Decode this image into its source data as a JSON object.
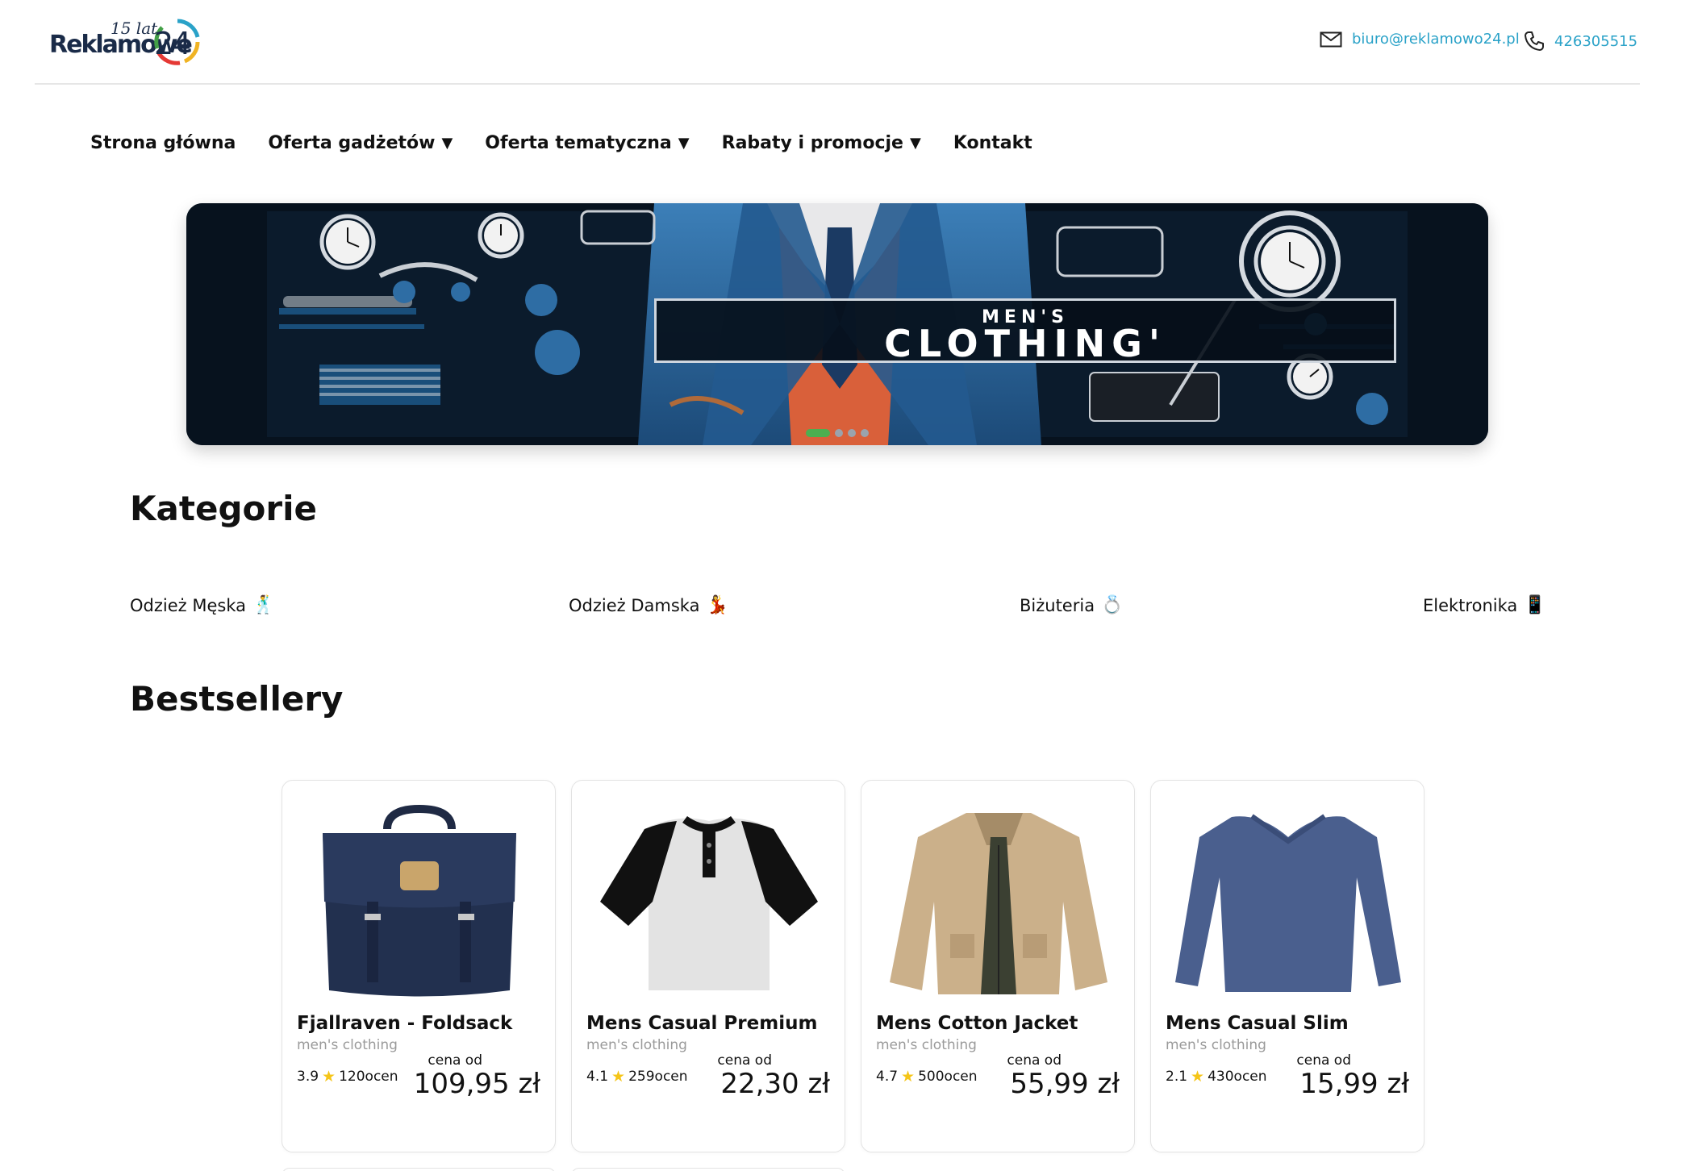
{
  "header": {
    "logo_main": "Reklamowe",
    "logo_years": "15 lat",
    "logo_number": "24",
    "email": "biuro@reklamowo24.pl",
    "phone": "426305515"
  },
  "nav": {
    "items": [
      {
        "label": "Strona główna",
        "has_dropdown": false
      },
      {
        "label": "Oferta gadżetów",
        "has_dropdown": true
      },
      {
        "label": "Oferta tematyczna",
        "has_dropdown": true
      },
      {
        "label": "Rabaty i promocje",
        "has_dropdown": true
      },
      {
        "label": "Kontakt",
        "has_dropdown": false
      }
    ],
    "caret": "▼"
  },
  "banner": {
    "title_top": "MEN'S",
    "title_main": "CLOTHING'",
    "slide_count": 4,
    "active_slide": 1,
    "active_dot_color": "#4caf50"
  },
  "categories": {
    "heading": "Kategorie",
    "items": [
      {
        "label": "Odzież Męska",
        "emoji": "🕺"
      },
      {
        "label": "Odzież Damska",
        "emoji": "💃"
      },
      {
        "label": "Biżuteria",
        "emoji": "💍"
      },
      {
        "label": "Elektronika",
        "emoji": "📱"
      }
    ]
  },
  "bestsellers": {
    "heading": "Bestsellery",
    "price_from_label": "cena od",
    "reviews_suffix": "ocen",
    "products": [
      {
        "title": "Fjallraven - Foldsack",
        "category": "men's clothing",
        "rating": "3.9",
        "reviews": "120ocen",
        "price": "109,95 zł",
        "image": "backpack"
      },
      {
        "title": "Mens Casual Premium",
        "category": "men's clothing",
        "rating": "4.1",
        "reviews": "259ocen",
        "price": "22,30 zł",
        "image": "raglan-tshirt"
      },
      {
        "title": "Mens Cotton Jacket",
        "category": "men's clothing",
        "rating": "4.7",
        "reviews": "500ocen",
        "price": "55,99 zł",
        "image": "cotton-jacket"
      },
      {
        "title": "Mens Casual Slim",
        "category": "men's clothing",
        "rating": "2.1",
        "reviews": "430ocen",
        "price": "15,99 zł",
        "image": "slim-longsleeve"
      }
    ]
  },
  "colors": {
    "accent": "#2aa2c8",
    "text": "#111111",
    "muted": "#9a9a9a",
    "star": "#f5c518"
  }
}
